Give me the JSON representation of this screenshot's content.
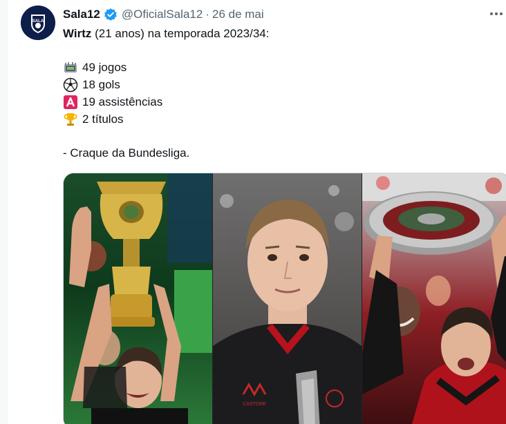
{
  "tweet": {
    "author_name": "Sala12",
    "handle": "@OficialSala12",
    "separator": "·",
    "date": "26 de mai",
    "avatar_text": "SALA",
    "lines": {
      "l1_bold": "Wirtz",
      "l1_rest": " (21 anos) na temporada 2023/34:",
      "l2": "49 jogos",
      "l3": "18 gols",
      "l4": "19 assistências",
      "l5": "2 títulos",
      "l6": "- Craque da Bundesliga."
    },
    "emoji_icons": [
      "stadium-icon",
      "soccer-ball-icon",
      "letter-a-icon",
      "trophy-icon"
    ]
  },
  "media": {
    "panels": [
      "trophy-celebration-photo",
      "portrait-photo",
      "shield-celebration-photo"
    ],
    "jersey_text": "CASTORE"
  },
  "colors": {
    "verified": "#1d9bf0",
    "text": "#0f1419",
    "muted": "#536471"
  }
}
